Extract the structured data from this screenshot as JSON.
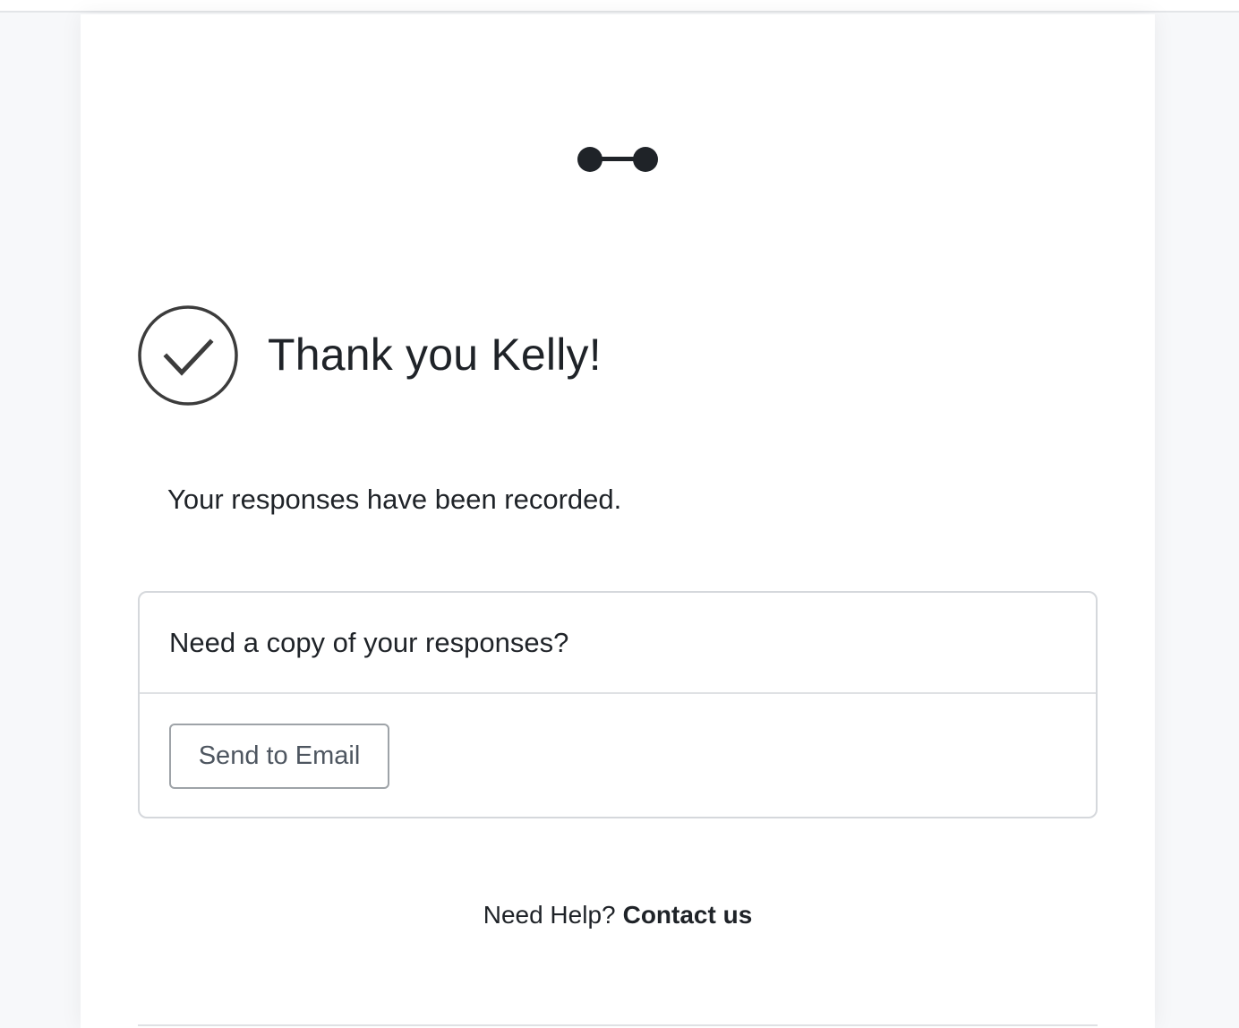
{
  "logo": {
    "icon": "dumbbell-connector-icon"
  },
  "confirmation": {
    "icon": "checkmark-circle-icon",
    "title": "Thank you Kelly!",
    "message": "Your responses have been recorded."
  },
  "copy_panel": {
    "question": "Need a copy of your responses?",
    "button_label": "Send to Email"
  },
  "help": {
    "prefix": "Need Help?",
    "link_label": "Contact us"
  },
  "colors": {
    "text": "#1f2328",
    "border": "#d5d8dc",
    "button_border": "#9ea3a8",
    "button_text": "#4e5660",
    "page_background": "#f7f8fa"
  }
}
